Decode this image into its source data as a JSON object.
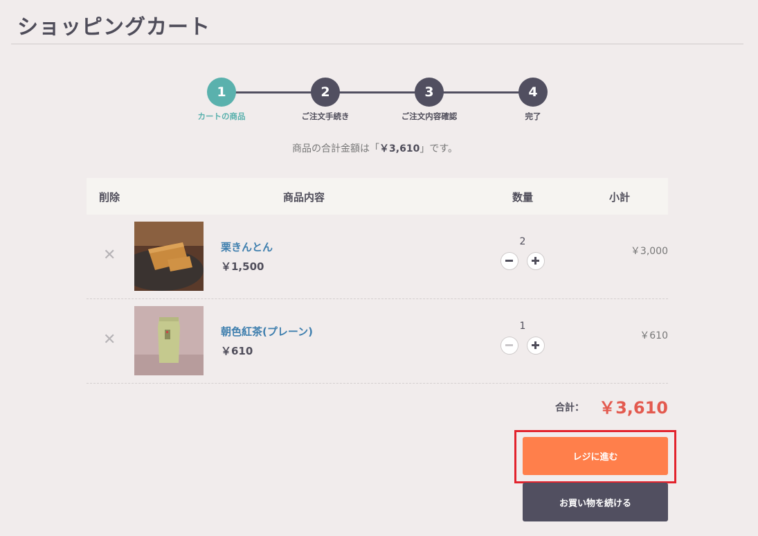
{
  "page": {
    "title": "ショッピングカート"
  },
  "steps": [
    {
      "number": "1",
      "label": "カートの商品",
      "active": true
    },
    {
      "number": "2",
      "label": "ご注文手続き",
      "active": false
    },
    {
      "number": "3",
      "label": "ご注文内容確認",
      "active": false
    },
    {
      "number": "4",
      "label": "完了",
      "active": false
    }
  ],
  "summary": {
    "prefix": "商品の合計金額は「",
    "amount": "￥3,610",
    "suffix": "」です。"
  },
  "table": {
    "headers": {
      "remove": "削除",
      "product": "商品内容",
      "quantity": "数量",
      "subtotal": "小計"
    },
    "rows": [
      {
        "remove": "✕",
        "name": "栗きんとん",
        "price": "￥1,500",
        "quantity": "2",
        "subtotal": "￥3,000"
      },
      {
        "remove": "✕",
        "name": "朝色紅茶(プレーン)",
        "price": "￥610",
        "quantity": "1",
        "subtotal": "￥610"
      }
    ]
  },
  "total": {
    "label": "合計：",
    "value": "￥3,610"
  },
  "buttons": {
    "checkout": "レジに進む",
    "continue": "お買い物を続ける"
  },
  "colors": {
    "accent": "#5ab1ad",
    "checkout": "#ff7f4b",
    "dark": "#514f60",
    "total": "#e35a4f",
    "highlight": "#e2232d"
  }
}
